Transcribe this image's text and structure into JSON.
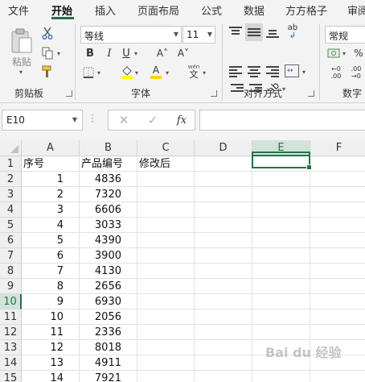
{
  "menu": [
    "文件",
    "开始",
    "插入",
    "页面布局",
    "公式",
    "数据",
    "方方格子",
    "审阅"
  ],
  "active_menu": "开始",
  "ribbon": {
    "clipboard": {
      "paste_label": "粘贴",
      "group_label": "剪贴板"
    },
    "font": {
      "font_name": "等线",
      "font_size": "11",
      "bold": "B",
      "italic": "I",
      "underline": "U",
      "grow": "A˄",
      "shrink": "A˅",
      "font_color_letter": "A",
      "phonetic": "wén",
      "group_label": "字体"
    },
    "alignment": {
      "wrap_label": "ab",
      "group_label": "对齐方式"
    },
    "number": {
      "format": "常规",
      "percent": "%",
      "group_label": "数字"
    }
  },
  "formula_bar": {
    "name_box": "E10",
    "fx": "fx",
    "formula": ""
  },
  "sheet": {
    "columns": [
      "A",
      "B",
      "C",
      "D",
      "E",
      "F"
    ],
    "selected_column": "E",
    "selected_row": "10",
    "rows": [
      {
        "n": "1",
        "a": "序号",
        "b": "产品编号",
        "c": "修改后"
      },
      {
        "n": "2",
        "a": "1",
        "b": "4836",
        "c": ""
      },
      {
        "n": "3",
        "a": "2",
        "b": "7320",
        "c": ""
      },
      {
        "n": "4",
        "a": "3",
        "b": "6606",
        "c": ""
      },
      {
        "n": "5",
        "a": "4",
        "b": "3033",
        "c": ""
      },
      {
        "n": "6",
        "a": "5",
        "b": "4390",
        "c": ""
      },
      {
        "n": "7",
        "a": "6",
        "b": "3900",
        "c": ""
      },
      {
        "n": "8",
        "a": "7",
        "b": "4130",
        "c": ""
      },
      {
        "n": "9",
        "a": "8",
        "b": "2656",
        "c": ""
      },
      {
        "n": "10",
        "a": "9",
        "b": "6930",
        "c": ""
      },
      {
        "n": "11",
        "a": "10",
        "b": "2056",
        "c": ""
      },
      {
        "n": "12",
        "a": "11",
        "b": "2336",
        "c": ""
      },
      {
        "n": "13",
        "a": "12",
        "b": "8018",
        "c": ""
      },
      {
        "n": "14",
        "a": "13",
        "b": "4911",
        "c": ""
      },
      {
        "n": "15",
        "a": "14",
        "b": "7921",
        "c": ""
      }
    ]
  },
  "watermark": "Bai du 经验",
  "colors": {
    "accent": "#217346",
    "selected_header": "#d3e3d9",
    "font_color_bar": "#ffd800",
    "fill_color_bar": "#ffff00"
  }
}
